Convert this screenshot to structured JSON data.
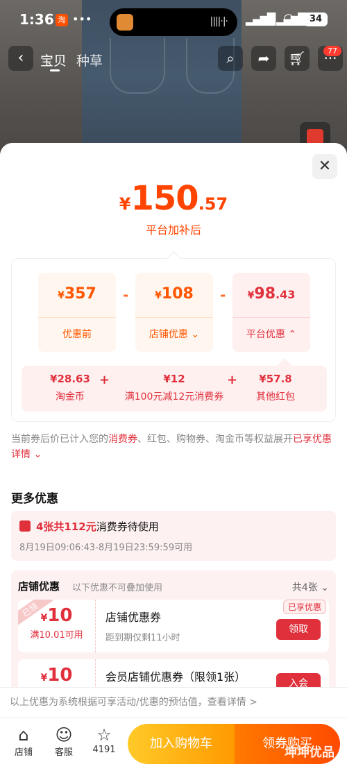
{
  "status": {
    "time": "1:36",
    "tao_badge": "淘",
    "battery": "34"
  },
  "nav": {
    "tab1": "宝贝",
    "tab2": "种草",
    "cart_badge": "77"
  },
  "price": {
    "currency": "¥",
    "integer": "150",
    "decimal": ".57",
    "subtitle": "平台加补后"
  },
  "breakdown": {
    "before": {
      "cur": "¥",
      "amount": "357",
      "label": "优惠前"
    },
    "store": {
      "cur": "¥",
      "amount": "108",
      "label": "店铺优惠"
    },
    "platform": {
      "cur": "¥",
      "amount": "98",
      "decimal": ".43",
      "label": "平台优惠"
    },
    "minus": "-",
    "plus": "+"
  },
  "platform_detail": [
    {
      "value": "¥28.63",
      "label": "淘金币"
    },
    {
      "value": "¥12",
      "label": "满100元减12元消费券"
    },
    {
      "value": "¥57.8",
      "label": "其他红包"
    }
  ],
  "note": {
    "p1": "当前券后价已计入您的",
    "hl1": "消费券",
    "p2": "、红包、购物券、淘金币等权益展开",
    "hl2": "已享优惠详情"
  },
  "more": {
    "title": "更多优惠",
    "voucher": {
      "highlight": "4张共112元",
      "text": "消费券待使用",
      "time": "8月19日09:06:43-8月19日23:59:59可用"
    },
    "shop": {
      "title": "店铺优惠",
      "subtitle": "以下优惠不可叠加使用",
      "count": "共4张",
      "coupons": [
        {
          "ribbon": "已领",
          "cur": "¥",
          "amount": "10",
          "cond": "满10.01可用",
          "name": "店铺优惠券",
          "expire": "距到期仅剩11小时",
          "btn": "领取",
          "tag": "已享优惠"
        },
        {
          "cur": "¥",
          "amount": "10",
          "name": "会员店铺优惠券（限领1张）",
          "btn": "入会"
        }
      ]
    }
  },
  "disclaimer": "以上优惠为系统根据可享活动/优惠的预估值，查看详情 >",
  "bottom": {
    "store": "店铺",
    "service": "客服",
    "fav_count": "4191",
    "cart": "加入购物车",
    "buy": "领券购买",
    "watermark": "坤坤优品"
  }
}
